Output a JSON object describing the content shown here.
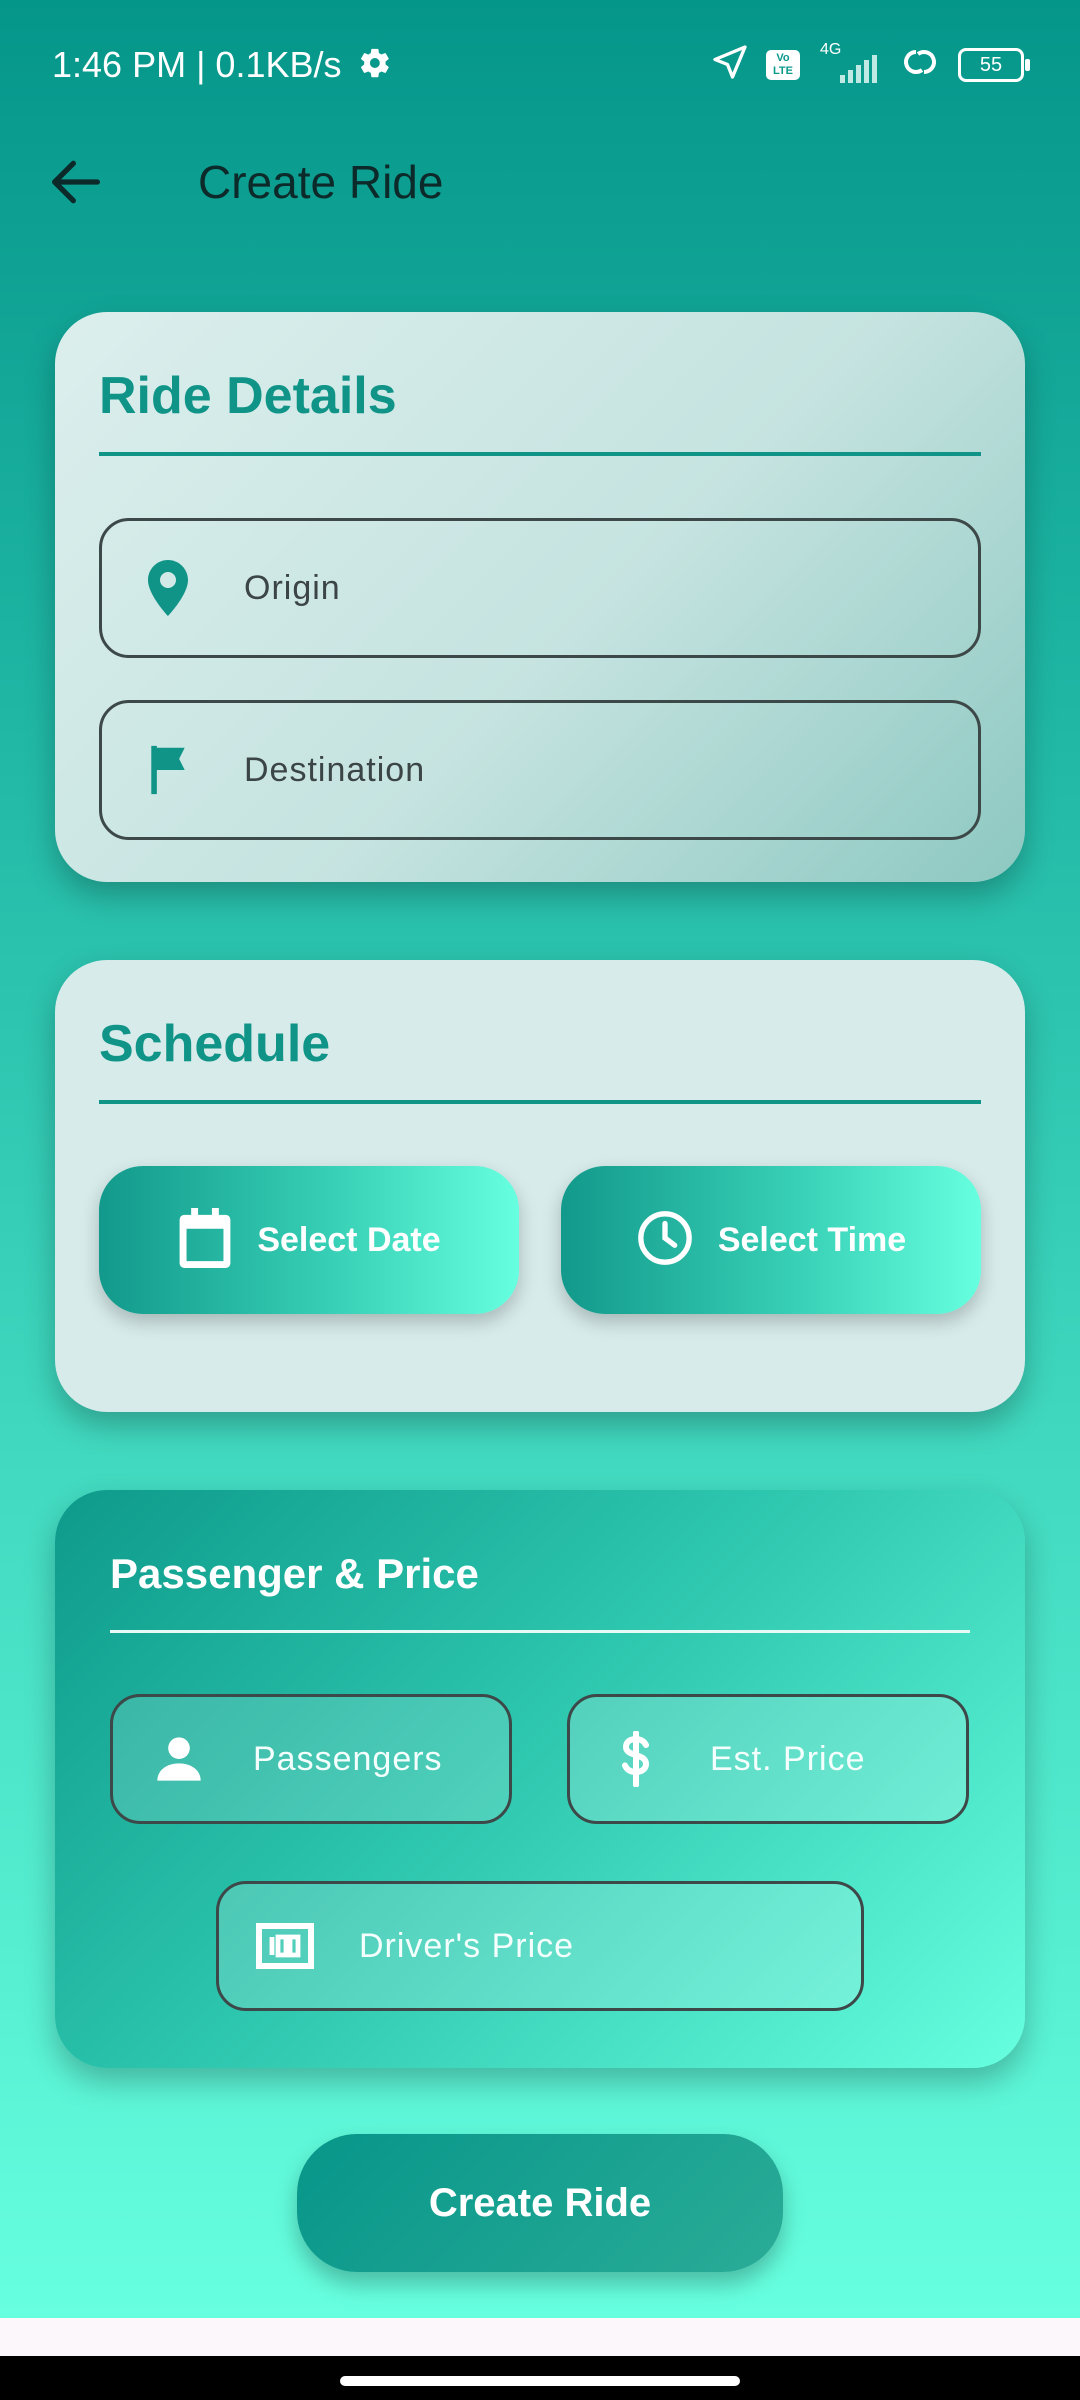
{
  "status_bar": {
    "time_speed": "1:46 PM | 0.1KB/s",
    "network": "4G",
    "volte": "Vo LTE",
    "battery": "55"
  },
  "app_bar": {
    "title": "Create Ride"
  },
  "ride_details": {
    "title": "Ride Details",
    "origin_placeholder": "Origin",
    "destination_placeholder": "Destination"
  },
  "schedule": {
    "title": "Schedule",
    "select_date_label": "Select Date",
    "select_time_label": "Select Time"
  },
  "passenger_price": {
    "title": "Passenger & Price",
    "passengers_placeholder": "Passengers",
    "est_price_placeholder": "Est. Price",
    "drivers_price_placeholder": "Driver's Price"
  },
  "create_button_label": "Create Ride",
  "colors": {
    "accent": "#109488",
    "gradient_top": "#05968a",
    "gradient_bottom": "#66ffdf"
  }
}
